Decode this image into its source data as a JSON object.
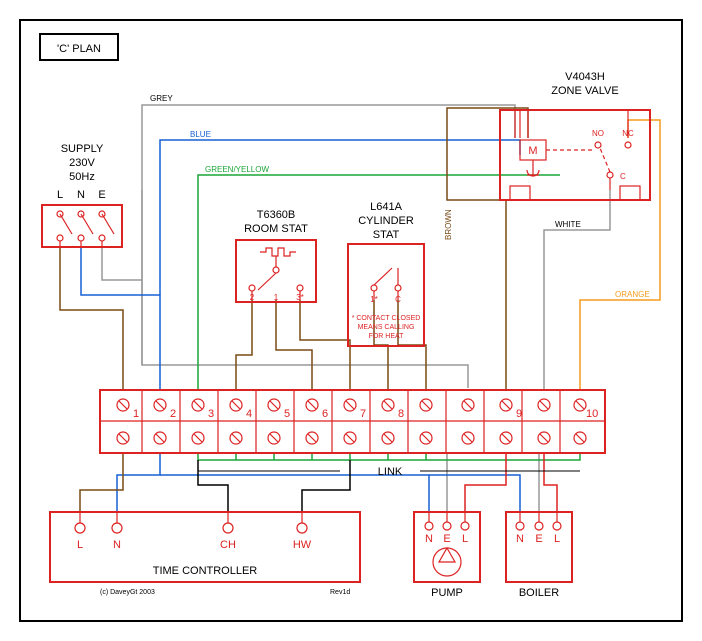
{
  "title": "'C' PLAN",
  "supply": {
    "label": "SUPPLY",
    "voltage": "230V",
    "freq": "50Hz",
    "pins": [
      "L",
      "N",
      "E"
    ]
  },
  "zone_valve": {
    "model": "V4043H",
    "label": "ZONE VALVE",
    "pins": {
      "m": "M",
      "no": "NO",
      "nc": "NC",
      "c": "C"
    }
  },
  "room_stat": {
    "model": "T6360B",
    "label": "ROOM STAT",
    "pins": [
      "2",
      "1",
      "3*"
    ]
  },
  "cylinder_stat": {
    "model": "L641A",
    "label": "CYLINDER",
    "label2": "STAT",
    "pins": [
      "1*",
      "C"
    ],
    "note1": "* CONTACT CLOSED",
    "note2": "MEANS CALLING",
    "note3": "FOR HEAT"
  },
  "terminal": {
    "pins": [
      "1",
      "2",
      "3",
      "4",
      "5",
      "6",
      "7",
      "8",
      "9",
      "10"
    ],
    "link": "LINK"
  },
  "time_controller": {
    "label": "TIME CONTROLLER",
    "pins": [
      "L",
      "N",
      "CH",
      "HW"
    ],
    "copyright": "(c) DaveyGt 2003",
    "rev": "Rev1d"
  },
  "pump": {
    "label": "PUMP",
    "pins": [
      "N",
      "E",
      "L"
    ]
  },
  "boiler": {
    "label": "BOILER",
    "pins": [
      "N",
      "E",
      "L"
    ]
  },
  "wire_labels": {
    "grey": "GREY",
    "blue": "BLUE",
    "greenyellow": "GREEN/YELLOW",
    "brown": "BROWN",
    "white": "WHITE",
    "orange": "ORANGE"
  }
}
